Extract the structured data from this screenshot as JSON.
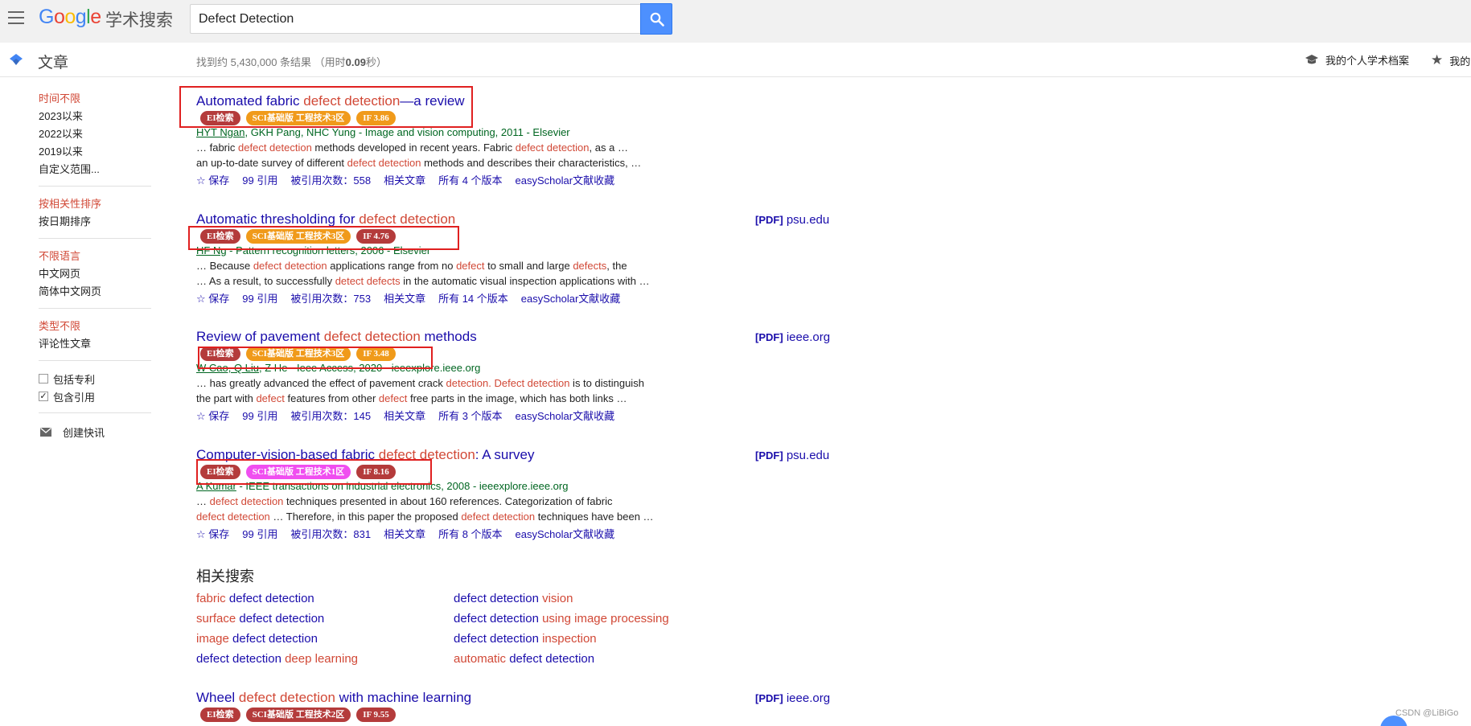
{
  "header": {
    "logo": {
      "g1": "G",
      "o1": "o",
      "o2": "o",
      "g2": "g",
      "l": "l",
      "e": "e"
    },
    "logo_sub": "学术搜索",
    "search_value": "Defect Detection"
  },
  "subbar": {
    "title": "文章",
    "stats_prefix": "找到约 5,430,000 条结果  （用时",
    "stats_time": "0.09",
    "stats_suffix": "秒）",
    "profile_label": "我的个人学术档案",
    "library_label": "我的"
  },
  "sidebar": {
    "time": [
      "时间不限",
      "2023以来",
      "2022以来",
      "2019以来",
      "自定义范围..."
    ],
    "sort": [
      "按相关性排序",
      "按日期排序"
    ],
    "lang": [
      "不限语言",
      "中文网页",
      "简体中文网页"
    ],
    "type": [
      "类型不限",
      "评论性文章"
    ],
    "patents_label": "包括专利",
    "citations_label": "包含引用",
    "citations_checked": "✓",
    "alert_label": "创建快讯"
  },
  "results": [
    {
      "title": [
        "Automated fabric ",
        "defect detection",
        "—a review"
      ],
      "badges": [
        "EI检索",
        "SCI基础版 工程技术3区",
        "IF 3.86"
      ],
      "authors_u": "HYT Ngan",
      "authors_rest": ", GKH Pang, NHC Yung - Image and vision computing, 2011 - Elsevier",
      "snippet1": [
        "… fabric ",
        "defect detection",
        " methods developed in recent years. Fabric ",
        "defect detection",
        ", as a …"
      ],
      "snippet2": [
        "an up-to-date survey of different ",
        "defect detection",
        " methods and describes their characteristics, …"
      ],
      "actions": [
        "☆ 保存",
        "99 引用",
        "被引用次数：558",
        "相关文章",
        "所有 4 个版本",
        "easyScholar文献收藏"
      ]
    },
    {
      "title": [
        "Automatic thresholding for ",
        "defect detection",
        ""
      ],
      "badges": [
        "EI检索",
        "SCI基础版 工程技术3区",
        "IF 4.76"
      ],
      "pdf_tag": "[PDF]",
      "pdf_site": "psu.edu",
      "authors_u": "HF Ng",
      "authors_rest": " - Pattern recognition letters, 2006 - Elsevier",
      "snippet1": [
        "… Because ",
        "defect detection",
        " applications range from no ",
        "defect",
        " to small and large ",
        "defects",
        ", the"
      ],
      "snippet2": [
        "… As a result, to successfully ",
        "detect defects",
        " in the automatic visual inspection applications with …"
      ],
      "actions": [
        "☆ 保存",
        "99 引用",
        "被引用次数：753",
        "相关文章",
        "所有 14 个版本",
        "easyScholar文献收藏"
      ]
    },
    {
      "title": [
        "Review of pavement ",
        "defect detection",
        " methods"
      ],
      "badges": [
        "EI检索",
        "SCI基础版 工程技术3区",
        "IF 3.48"
      ],
      "pdf_tag": "[PDF]",
      "pdf_site": "ieee.org",
      "authors_u": "W Cao, Q Liu",
      "authors_rest": ", Z He - Ieee Access, 2020 - ieeexplore.ieee.org",
      "snippet1": [
        "… has greatly advanced the effect of pavement crack ",
        "detection. Defect detection",
        " is to distinguish"
      ],
      "snippet2": [
        "the part with ",
        "defect",
        " features from other ",
        "defect",
        " free parts in the image, which has both links …"
      ],
      "actions": [
        "☆ 保存",
        "99 引用",
        "被引用次数：145",
        "相关文章",
        "所有 3 个版本",
        "easyScholar文献收藏"
      ]
    },
    {
      "title": [
        "Computer-vision-based fabric ",
        "defect detection",
        ": A survey"
      ],
      "badges": [
        "EI检索",
        "SCI基础版 工程技术1区",
        "IF 8.16"
      ],
      "pdf_tag": "[PDF]",
      "pdf_site": "psu.edu",
      "authors_u": "A Kumar",
      "authors_rest": " - IEEE transactions on industrial electronics, 2008 - ieeexplore.ieee.org",
      "snippet1": [
        "… ",
        "defect detection",
        " techniques presented in about 160 references. Categorization of fabric"
      ],
      "snippet2": [
        "defect detection",
        " … Therefore, in this paper the proposed ",
        "defect detection",
        " techniques have been …"
      ],
      "actions": [
        "☆ 保存",
        "99 引用",
        "被引用次数：831",
        "相关文章",
        "所有 8 个版本",
        "easyScholar文献收藏"
      ]
    },
    {
      "title": [
        "Wheel ",
        "defect detection",
        " with machine learning"
      ],
      "badges": [
        "EI检索",
        "SCI基础版 工程技术2区",
        "IF 9.55"
      ],
      "pdf_tag": "[PDF]",
      "pdf_site": "ieee.org"
    }
  ],
  "related": {
    "heading": "相关搜索",
    "items": [
      [
        "fabric ",
        "defect detection",
        ""
      ],
      [
        "",
        "defect detection",
        " vision"
      ],
      [
        "surface ",
        "defect detection",
        ""
      ],
      [
        "",
        "defect detection",
        " using image processing"
      ],
      [
        "image ",
        "defect detection",
        ""
      ],
      [
        "",
        "defect detection",
        " inspection"
      ],
      [
        "",
        "defect detection",
        " deep learning"
      ],
      [
        "automatic ",
        "defect detection",
        ""
      ]
    ]
  },
  "watermark": "CSDN @LiBiGo",
  "colors": {
    "link": "#1a0dab",
    "highlight": "#d14836",
    "author_green": "#006621",
    "annotation_box": "#e02020",
    "badge_ei": "#b43b3b",
    "badge_sci": "#f09a1a",
    "badge_sci1": "#f04ef0"
  }
}
